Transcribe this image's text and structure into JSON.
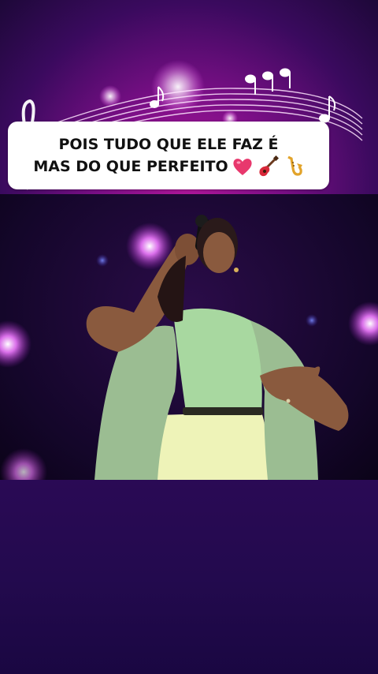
{
  "caption": {
    "line1": "POIS TUDO QUE ELE FAZ É",
    "line2": "MAS DO QUE PERFEITO"
  },
  "icons": [
    "heart-icon",
    "guitar-icon",
    "saxophone-icon",
    "music-notes-icon",
    "treble-clef-icon",
    "microphone-icon"
  ],
  "colors": {
    "background_top": "#7a0f86",
    "background_bottom": "#230a4e",
    "caption_background": "#ffffff",
    "caption_text": "#111111",
    "heart": "#e8386d",
    "stage_light": "#e05cff"
  }
}
